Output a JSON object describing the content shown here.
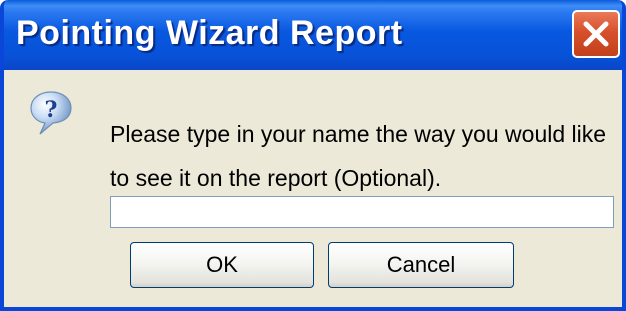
{
  "window": {
    "title": "Pointing Wizard Report"
  },
  "titlebar": {
    "close_icon": "close-icon",
    "close_color": "#d8502c"
  },
  "dialog": {
    "icon": "question-icon",
    "message": "Please type in your name the way you would like to see it on the report (Optional).",
    "name_input_value": ""
  },
  "buttons": {
    "ok_label": "OK",
    "cancel_label": "Cancel"
  },
  "colors": {
    "titlebar_blue": "#0858e0",
    "dialog_background": "#ece9d8",
    "button_border": "#003c74"
  }
}
